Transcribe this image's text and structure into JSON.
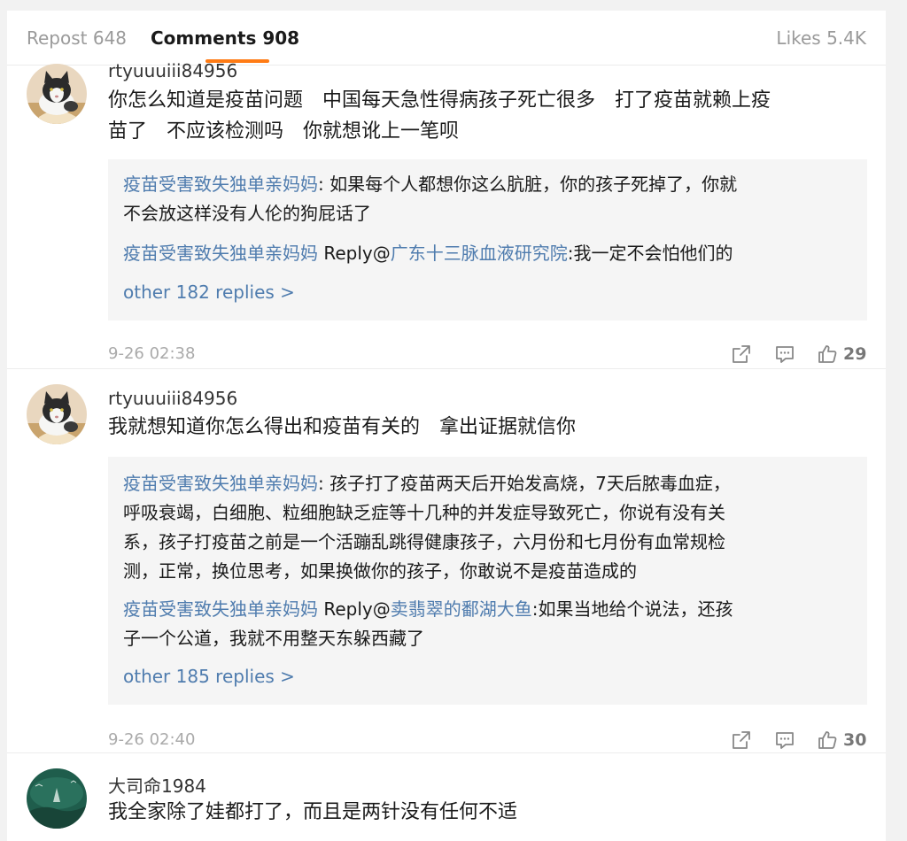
{
  "tabs": {
    "repost": "Repost 648",
    "comments": "Comments 908",
    "likes": "Likes 5.4K"
  },
  "colors": {
    "accent_underline": "#ff7b14",
    "link_blue": "#4f7cae",
    "muted_text": "#9a9a9a"
  },
  "comments": [
    {
      "username": "rtyuuuiii84956",
      "text_line1": "你怎么知道是疫苗问题　中国每天急性得病孩子死亡很多　打了疫苗就赖上疫",
      "text_line2": "苗了　不应该检测吗　你就想讹上一笔呗",
      "replies": [
        {
          "name": "疫苗受害致失独单亲妈妈",
          "text": ": 如果每个人都想你这么肮脏，你的孩子死掉了，你就",
          "text2": "不会放这样没有人伦的狗屁话了"
        },
        {
          "name": "疫苗受害致失独单亲妈妈",
          "reply_prefix": " Reply@",
          "reply_to": "广东十三脉血液研究院",
          "text": ":我一定不会怕他们的"
        }
      ],
      "more_replies": "other 182 replies >",
      "time": "9-26 02:38",
      "like_count": "29",
      "icons": [
        "share-icon",
        "comment-icon",
        "thumbs-up-icon"
      ]
    },
    {
      "username": "rtyuuuiii84956",
      "text_line1": "我就想知道你怎么得出和疫苗有关的　拿出证据就信你",
      "replies": [
        {
          "name": "疫苗受害致失独单亲妈妈",
          "text": ": 孩子打了疫苗两天后开始发高烧，7天后脓毒血症，",
          "text2": "呼吸衰竭，白细胞、粒细胞缺乏症等十几种的并发症导致死亡，你说有没有关",
          "text3": "系，孩子打疫苗之前是一个活蹦乱跳得健康孩子，六月份和七月份有血常规检",
          "text4": "测，正常，换位思考，如果换做你的孩子，你敢说不是疫苗造成的"
        },
        {
          "name": "疫苗受害致失独单亲妈妈",
          "reply_prefix": " Reply@",
          "reply_to": "卖翡翠的鄱湖大鱼",
          "text": ":如果当地给个说法，还孩",
          "text2": "子一个公道，我就不用整天东躲西藏了"
        }
      ],
      "more_replies": "other 185 replies >",
      "time": "9-26 02:40",
      "like_count": "30",
      "icons": [
        "share-icon",
        "comment-icon",
        "thumbs-up-icon"
      ]
    },
    {
      "username": "大司命1984",
      "text_line1": "我全家除了娃都打了，而且是两针没有任何不适"
    }
  ]
}
